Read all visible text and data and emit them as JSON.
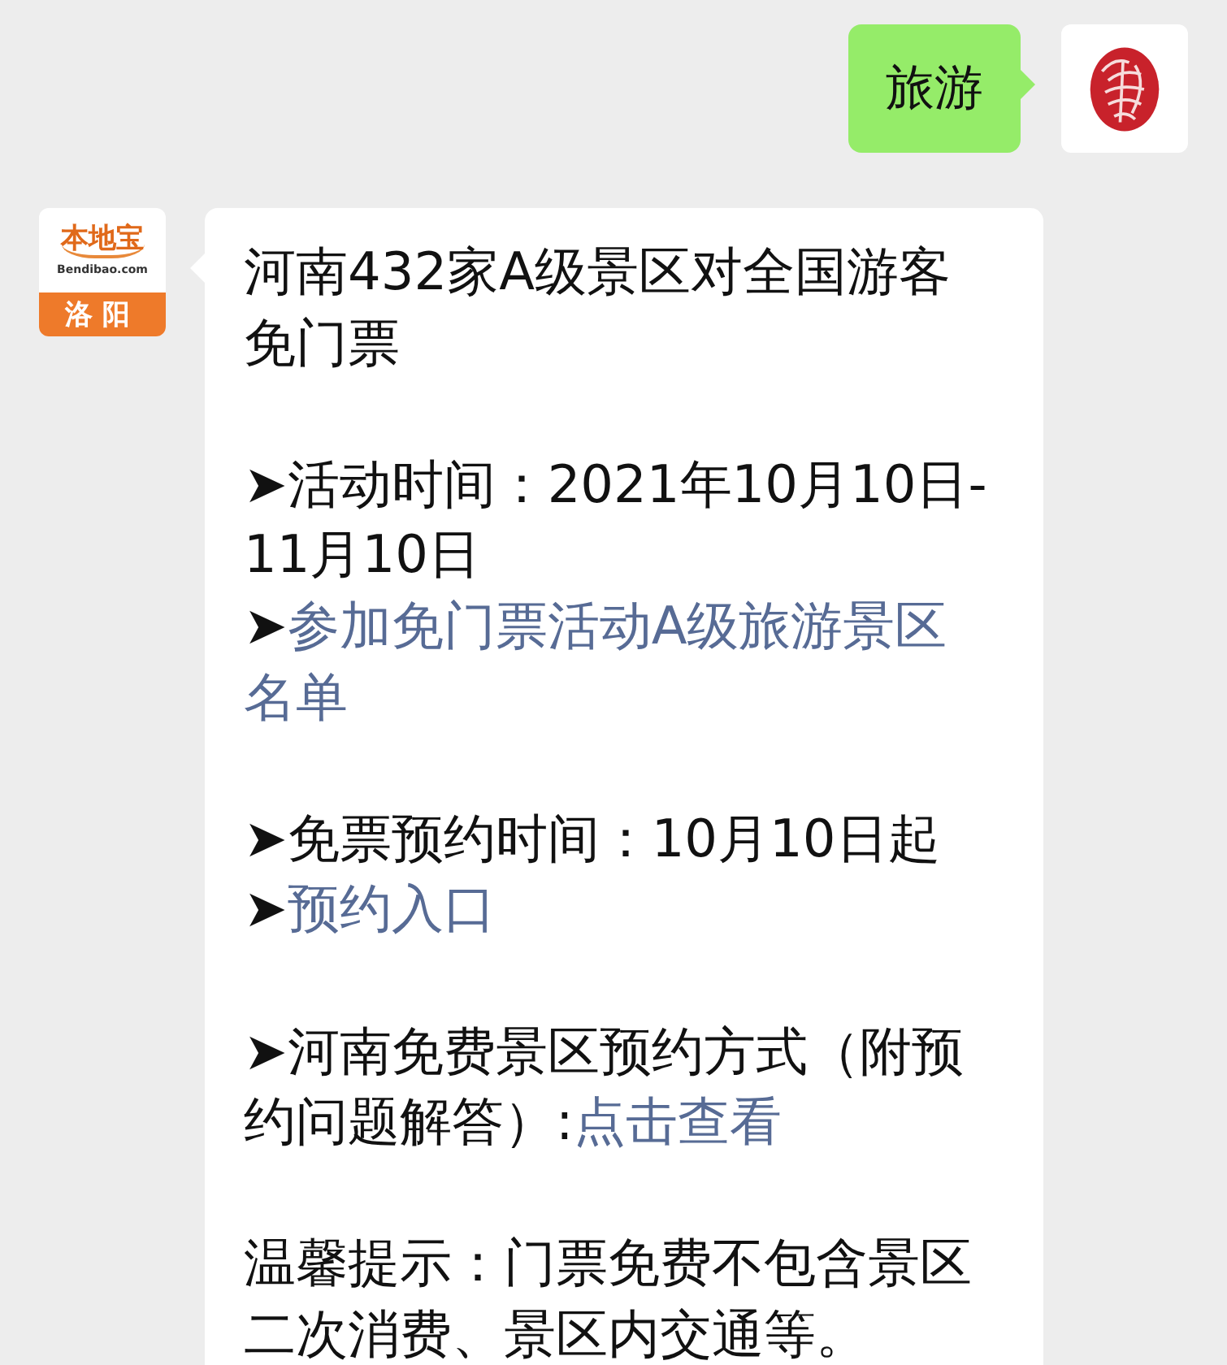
{
  "messages": [
    {
      "kind": "sent",
      "text": "旅游",
      "avatar": {
        "kind": "seal"
      }
    },
    {
      "kind": "received",
      "avatar": {
        "kind": "logo",
        "title": "本地宝",
        "site": "Bendibao.com",
        "city": "洛阳"
      },
      "paragraphs": [
        {
          "lines": [
            [
              {
                "text": "河南432家A级景区对全国游客",
                "link": false
              }
            ],
            [
              {
                "text": "免门票",
                "link": false
              }
            ]
          ]
        },
        {
          "lines": [
            [
              {
                "text": "➤活动时间：2021年10月10日-",
                "link": false
              }
            ],
            [
              {
                "text": "11月10日",
                "link": false
              }
            ],
            [
              {
                "text": "➤",
                "link": false
              },
              {
                "text": "参加免门票活动A级旅游景区",
                "link": true
              }
            ],
            [
              {
                "text": "名单",
                "link": true
              }
            ]
          ]
        },
        {
          "lines": [
            [
              {
                "text": "➤免票预约时间：10月10日起",
                "link": false
              }
            ],
            [
              {
                "text": "➤",
                "link": false
              },
              {
                "text": "预约入口",
                "link": true
              }
            ]
          ]
        },
        {
          "lines": [
            [
              {
                "text": "➤河南免费景区预约方式（附预",
                "link": false
              }
            ],
            [
              {
                "text": "约问题解答）:",
                "link": false
              },
              {
                "text": "点击查看",
                "link": true
              }
            ]
          ]
        },
        {
          "lines": [
            [
              {
                "text": "温馨提示：门票免费不包含景区",
                "link": false
              }
            ],
            [
              {
                "text": "二次消费、景区内交通等。",
                "link": false
              }
            ]
          ]
        }
      ]
    }
  ]
}
